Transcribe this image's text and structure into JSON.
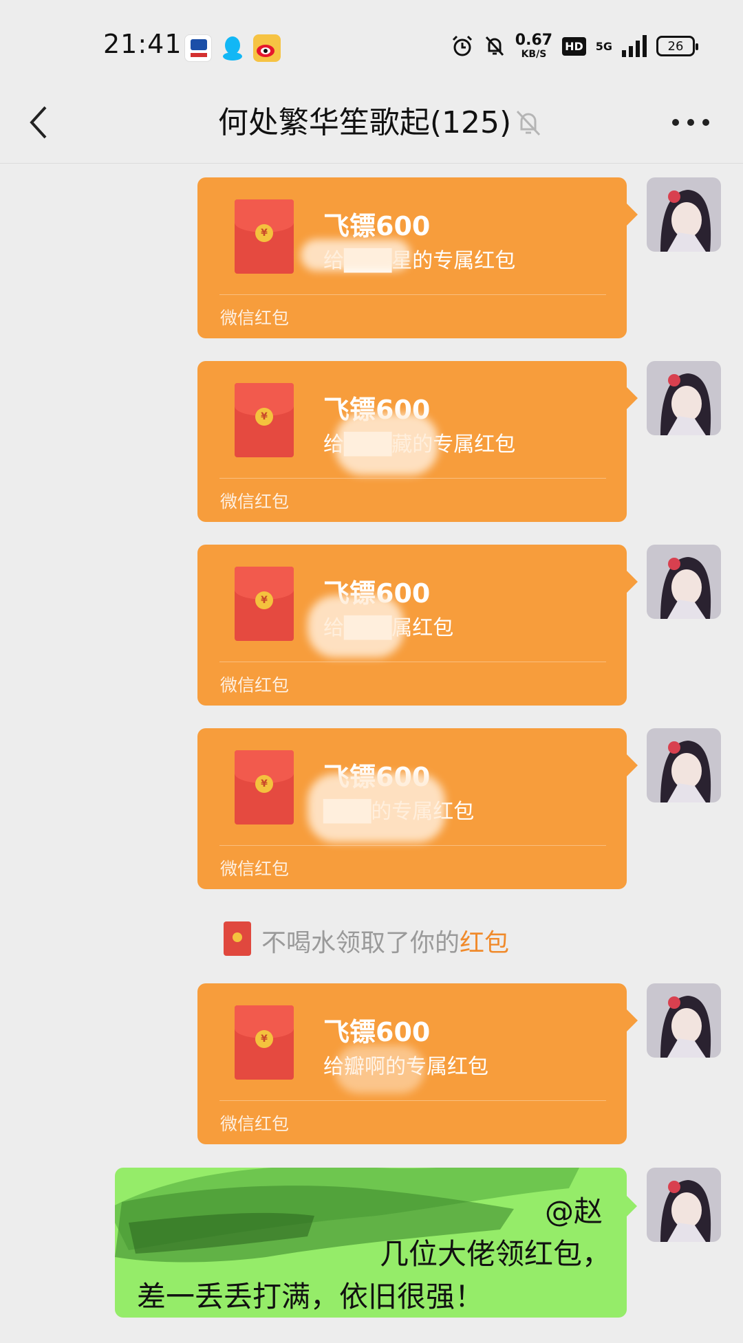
{
  "status_bar": {
    "time": "21:41",
    "net_speed_value": "0.67",
    "net_speed_unit": "KB/S",
    "hd": "HD",
    "network": "5G",
    "battery": "26"
  },
  "header": {
    "title": "何处繁华笙歌起(125)"
  },
  "messages": [
    {
      "title": "飞镖600",
      "subtitle": "给███星的专属红包",
      "footer": "微信红包"
    },
    {
      "title": "飞镖600",
      "subtitle": "给███藏的专属红包",
      "footer": "微信红包"
    },
    {
      "title": "飞镖600",
      "subtitle": "给███属红包",
      "footer": "微信红包"
    },
    {
      "title": "飞镖600",
      "subtitle": "███的专属红包",
      "footer": "微信红包"
    },
    {
      "title": "飞镖600",
      "subtitle": "给瓣啊的专属红包",
      "footer": "微信红包"
    }
  ],
  "system_notice": {
    "prefix": "不喝水领取了你的",
    "highlight": "红包"
  },
  "text_message": {
    "line1": "@赵",
    "line2": "几位大佬领红包，",
    "line3": "差一丢丢打满，依旧很强！"
  },
  "colors": {
    "background": "#ededed",
    "red_packet": "#f79d3c",
    "text_bubble": "#95ec69",
    "highlight": "#f08a2b"
  }
}
